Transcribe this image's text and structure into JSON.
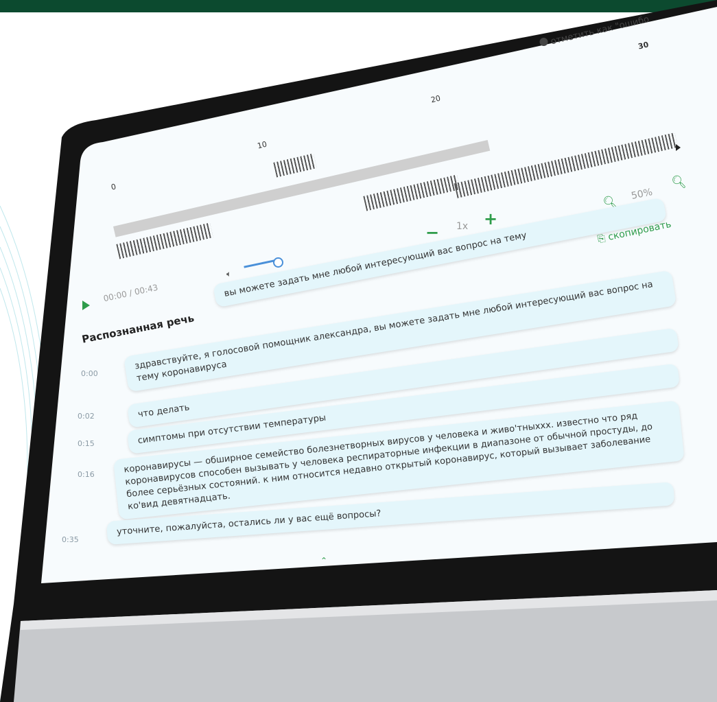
{
  "mark_link": "отметить как \"ошибо",
  "ruler_ticks": [
    "0",
    "10",
    "20",
    "30"
  ],
  "zoom_level": "50%",
  "speed": "1x",
  "copy_label": "скопировать",
  "time_display": "00:00 / 00:43",
  "section_title": "Распознанная речь",
  "messages": [
    {
      "time": "",
      "text": "вы можете задать мне любой интересующий вас вопрос на тему"
    },
    {
      "time": "0:00",
      "text": "здравствуйте, я голосовой помощник александра, вы можете задать мне любой интересующий вас вопрос на тему коронавируса"
    },
    {
      "time": "0:02",
      "text": "что делать"
    },
    {
      "time": "0:15",
      "text": "симптомы при отсутствии температуры"
    },
    {
      "time": "0:16",
      "text": "коронавирусы — обширное семейство болезнетворных вирусов у человека и живо'тныххх. известно что ряд коронавирусов способен вызывать у человека респираторные инфекции в диапазоне от обычной простуды, до более серьёзных состояний. к ним относится недавно открытый коронавирус, который вызывает заболевание ко'вид девятнадцать."
    },
    {
      "time": "0:35",
      "text": "уточните, пожалуйста, остались ли у вас ещё вопросы?"
    }
  ],
  "colors": {
    "accent": "#2e9c4a",
    "band": "#0c4a2f",
    "bubble": "#e4f6fb"
  }
}
